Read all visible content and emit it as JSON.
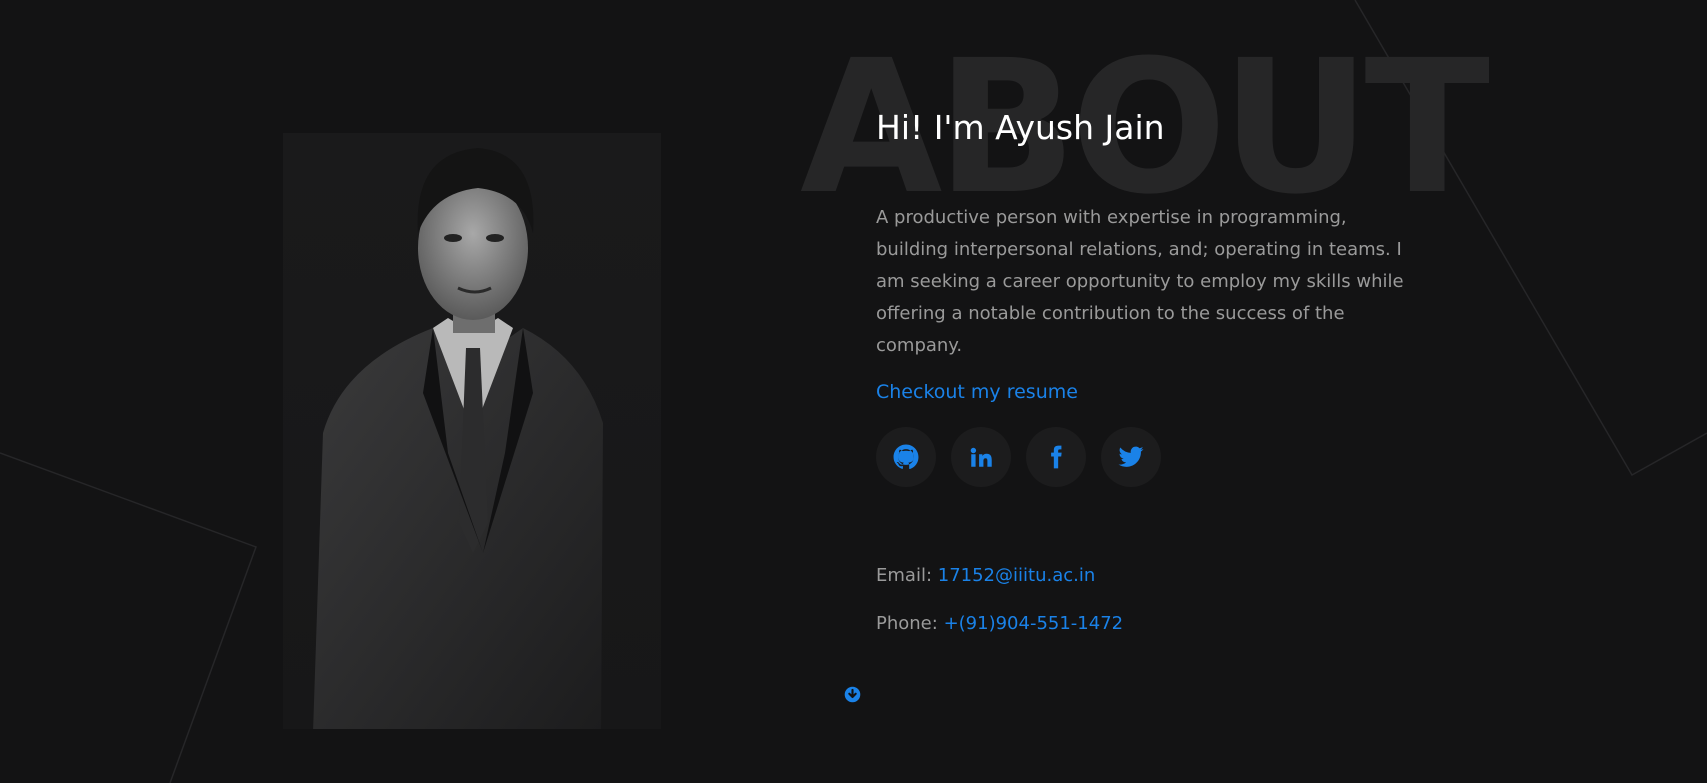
{
  "background_word": "ABOUT",
  "intro": {
    "greeting": "Hi! I'm Ayush Jain",
    "bio": "A productive person with expertise in programming, building interpersonal relations, and; operating in teams. I am seeking a career opportunity to employ my skills while offering a notable contribution to the success of the company.",
    "resume_link_label": "Checkout my resume"
  },
  "socials": [
    {
      "name": "github",
      "icon": "github-icon"
    },
    {
      "name": "linkedin",
      "icon": "linkedin-icon"
    },
    {
      "name": "facebook",
      "icon": "facebook-icon"
    },
    {
      "name": "twitter",
      "icon": "twitter-icon"
    }
  ],
  "contact": {
    "email_label": "Email:",
    "email_value": "17152@iiitu.ac.in",
    "phone_label": "Phone:",
    "phone_value": "+(91)904-551-1472"
  },
  "scroll_icon": "arrow-circle-down-icon",
  "colors": {
    "background": "#131314",
    "accent": "#1a82e8",
    "text_muted": "#9a9a9a",
    "heading": "#ffffff",
    "bg_word": "#262627",
    "social_bg": "#1c1c1d"
  }
}
